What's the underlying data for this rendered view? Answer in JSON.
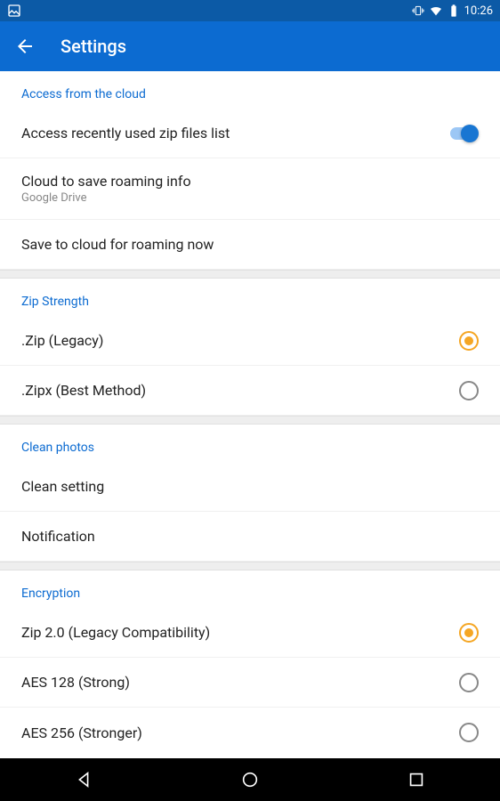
{
  "status": {
    "time": "10:26"
  },
  "app": {
    "title": "Settings"
  },
  "sections": {
    "cloud": {
      "header": "Access from the cloud",
      "access_recent": "Access recently used zip files list",
      "cloud_save_title": "Cloud to save roaming info",
      "cloud_save_subtitle": "Google Drive",
      "save_now": "Save to cloud for roaming now"
    },
    "zip": {
      "header": "Zip Strength",
      "legacy": ".Zip (Legacy)",
      "zipx": ".Zipx (Best Method)"
    },
    "photos": {
      "header": "Clean photos",
      "clean_setting": "Clean setting",
      "notification": "Notification"
    },
    "encryption": {
      "header": "Encryption",
      "zip20": "Zip 2.0 (Legacy Compatibility)",
      "aes128": "AES 128 (Strong)",
      "aes256": "AES 256 (Stronger)"
    }
  }
}
